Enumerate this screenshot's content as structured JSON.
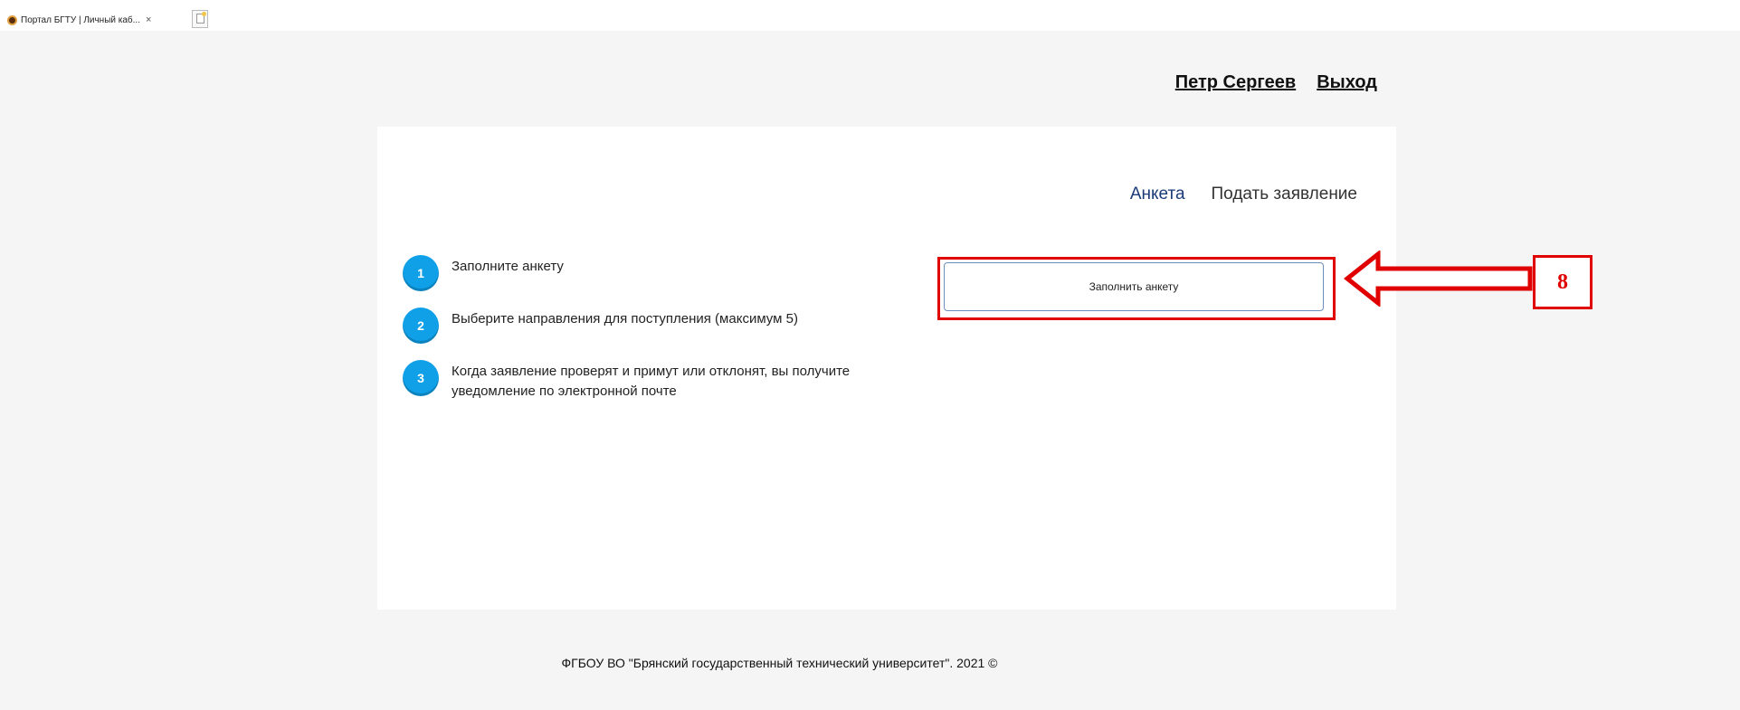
{
  "browser": {
    "tab_title": "Портал БГТУ | Личный каб...",
    "tab_close": "×"
  },
  "header": {
    "user_name": "Петр Сергеев",
    "logout": "Выход"
  },
  "nav": {
    "items": [
      {
        "label": "Анкета",
        "active": true
      },
      {
        "label": "Подать заявление",
        "active": false
      }
    ]
  },
  "steps": [
    {
      "num": "1",
      "text": "Заполните анкету"
    },
    {
      "num": "2",
      "text": "Выберите направления для поступления (максимум 5)"
    },
    {
      "num": "3",
      "text": "Когда заявление проверят и примут или отклонят, вы получите уведомление по электронной почте"
    }
  ],
  "main": {
    "fill_button": "Заполнить анкету"
  },
  "annotation": {
    "label": "8",
    "color": "#e00000"
  },
  "footer": {
    "text": "ФГБОУ ВО \"Брянский государственный технический университет\". 2021 ©"
  },
  "colors": {
    "accent": "#0fa0e8",
    "nav_active": "#1a3a78"
  }
}
